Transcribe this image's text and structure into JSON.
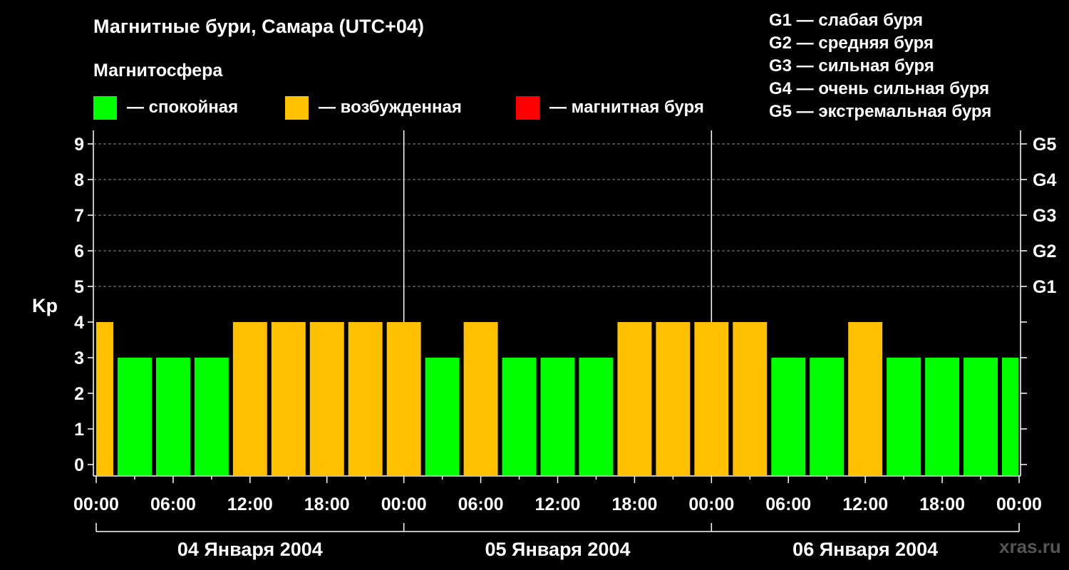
{
  "title": "Магнитные бури, Самара (UTC+04)",
  "subtitle": "Магнитосфера",
  "legend": [
    {
      "label": "— спокойная",
      "color": "#00FF00"
    },
    {
      "label": "— возбужденная",
      "color": "#FFC000"
    },
    {
      "label": "— магнитная буря",
      "color": "#FF0000"
    }
  ],
  "storm_levels": [
    "G1 — слабая буря",
    "G2 — средняя буря",
    "G3 — сильная буря",
    "G4 — очень сильная буря",
    "G5 — экстремальная буря"
  ],
  "watermark": "xras.ru",
  "chart_data": {
    "type": "bar",
    "ylabel": "Kp",
    "ylim": [
      0,
      9
    ],
    "y_ticks": [
      "0",
      "1",
      "2",
      "3",
      "4",
      "5",
      "6",
      "7",
      "8",
      "9"
    ],
    "right_ticks": [
      {
        "kp": 5,
        "label": "G1"
      },
      {
        "kp": 6,
        "label": "G2"
      },
      {
        "kp": 7,
        "label": "G3"
      },
      {
        "kp": 8,
        "label": "G4"
      },
      {
        "kp": 9,
        "label": "G5"
      }
    ],
    "x_ticks": [
      "00:00",
      "06:00",
      "12:00",
      "18:00",
      "00:00",
      "06:00",
      "12:00",
      "18:00",
      "00:00",
      "06:00",
      "12:00",
      "18:00",
      "00:00"
    ],
    "days": [
      "04 Января 2004",
      "05 Января 2004",
      "06 Января 2004"
    ],
    "hours_total": 72,
    "interval_hours": 3,
    "values": [
      4,
      3,
      3,
      3,
      4,
      4,
      4,
      4,
      4,
      3,
      4,
      3,
      3,
      3,
      4,
      4,
      4,
      4,
      3,
      3,
      4,
      3,
      3,
      3,
      3
    ],
    "colors": {
      "calm": "#00FF00",
      "active": "#FFC000",
      "storm": "#FF0000"
    },
    "thresholds": {
      "active": 4,
      "storm": 5
    },
    "grid": "dashed at Kp 5-9"
  }
}
